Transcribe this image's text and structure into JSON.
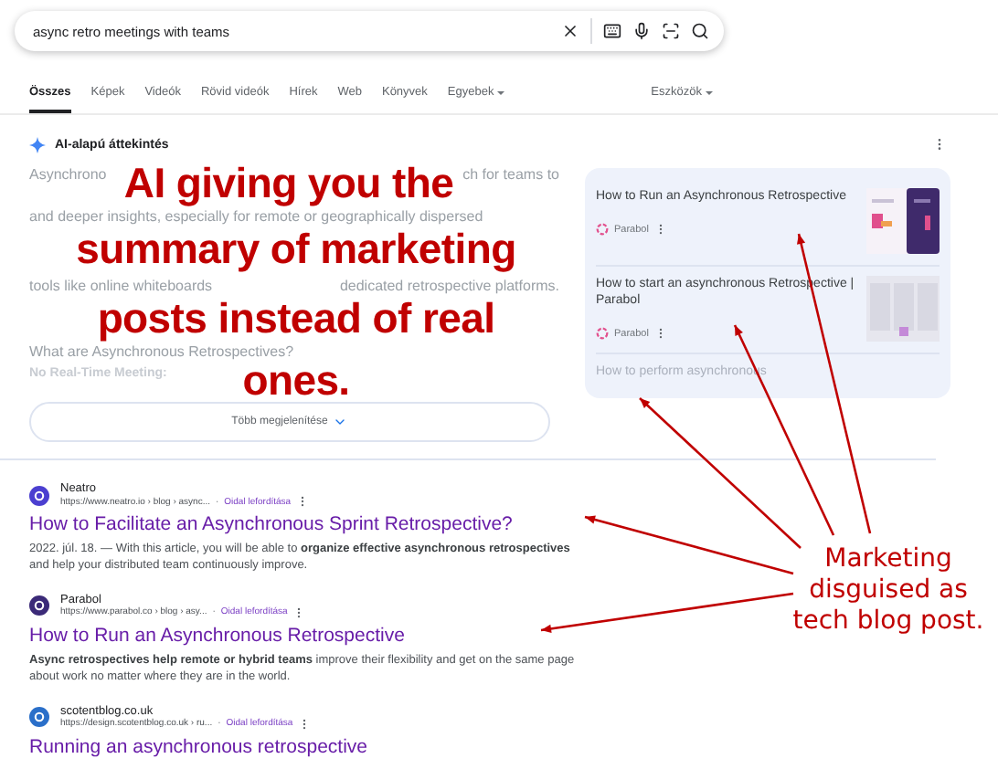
{
  "search": {
    "value": "async retro meetings with teams"
  },
  "tabs": [
    {
      "label": "Összes",
      "selected": true,
      "dropdown": false
    },
    {
      "label": "Képek",
      "selected": false,
      "dropdown": false
    },
    {
      "label": "Videók",
      "selected": false,
      "dropdown": false
    },
    {
      "label": "Rövid videók",
      "selected": false,
      "dropdown": false
    },
    {
      "label": "Hírek",
      "selected": false,
      "dropdown": false
    },
    {
      "label": "Web",
      "selected": false,
      "dropdown": false
    },
    {
      "label": "Könyvek",
      "selected": false,
      "dropdown": false
    },
    {
      "label": "Egyebek",
      "selected": false,
      "dropdown": true
    }
  ],
  "tools": {
    "label": "Eszközök"
  },
  "ai_overview": {
    "title": "AI-alapú áttekintés",
    "lines": [
      [
        "Asynchrono",
        "ch for teams to"
      ],
      [
        "and deeper insights, especially for remote or geographically dispersed"
      ],
      [
        "tools like online whiteboards",
        "dedicated retrospective platforms."
      ]
    ],
    "question": "What are Asynchronous Retrospectives?",
    "subheading": "No Real-Time Meeting:",
    "more_button": "Több megjelenítése",
    "sources": [
      {
        "title": "How to Run an Asynchronous Retrospective",
        "site": "Parabol",
        "faded": false
      },
      {
        "title": "How to start an asynchronous Retrospective | Parabol",
        "site": "Parabol",
        "faded": false
      },
      {
        "title": "How to perform asynchronous",
        "faded": true
      }
    ]
  },
  "results": [
    {
      "site": "Neatro",
      "url": "https://www.neatro.io › blog › async...",
      "separator": "·",
      "translate": "Oidal lefordítása",
      "title": "How to Facilitate an Asynchronous Sprint Retrospective?",
      "snippet": "2022. júl. 18. — With this article, you will be able to **organize effective asynchronous retrospectives** and help your distributed team continuously improve.",
      "color": "#4b3fd0"
    },
    {
      "site": "Parabol",
      "url": "https://www.parabol.co › blog › asy...",
      "separator": "·",
      "translate": "Oidal lefordítása",
      "title": "How to Run an Asynchronous Retrospective",
      "snippet": "**Async retrospectives help remote or hybrid teams** improve their flexibility and get on the same page about work no matter where they are in the world.",
      "color": "#3b2a78"
    },
    {
      "site": "scotentblog.co.uk",
      "url": "https://design.scotentblog.co.uk › ru...",
      "separator": "·",
      "translate": "Oidal lefordítása",
      "title": "Running an asynchronous retrospective",
      "color": "#2a6fc9"
    }
  ],
  "annotations": {
    "caption_lines": [
      "AI giving you the",
      "summary of marketing",
      "posts instead of real",
      "ones."
    ],
    "note": "Marketing disguised as tech blog post."
  }
}
